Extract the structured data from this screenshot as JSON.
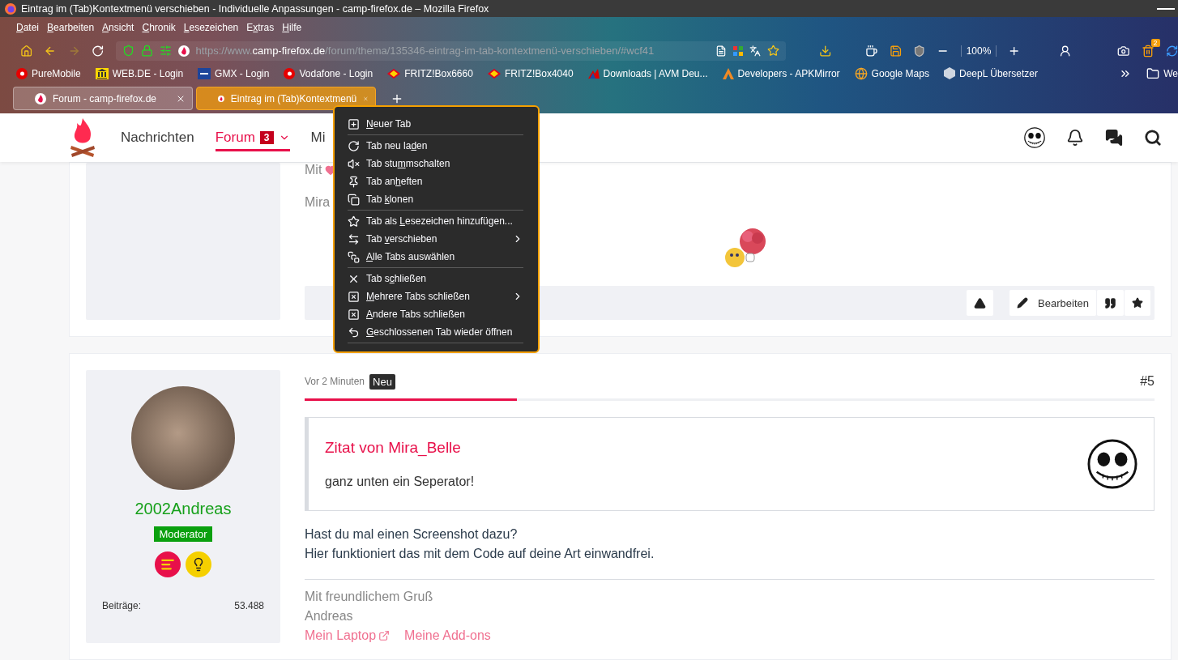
{
  "window": {
    "title": "Eintrag im (Tab)Kontextmenü verschieben - Individuelle Anpassungen - camp-firefox.de – Mozilla Firefox"
  },
  "menubar": [
    {
      "key": "D",
      "post": "atei"
    },
    {
      "key": "B",
      "post": "earbeiten"
    },
    {
      "key": "A",
      "post": "nsicht"
    },
    {
      "key": "C",
      "post": "hronik"
    },
    {
      "key": "L",
      "post": "esezeichen"
    },
    {
      "pre": "E",
      "key": "x",
      "post": "tras"
    },
    {
      "key": "H",
      "post": "ilfe"
    }
  ],
  "navbar": {
    "forward": {
      "disabled": true
    },
    "url": {
      "prefix": "https://www.",
      "host": "camp-firefox.de",
      "path": "/forum/thema/135346-eintrag-im-tab-kontextmenü-verschieben/#wcf41"
    },
    "zoom": "100%",
    "extension_badge": "2"
  },
  "bookmarks": [
    {
      "kind": "vodafone",
      "label": "PureMobile"
    },
    {
      "kind": "webde",
      "label": "WEB.DE - Login"
    },
    {
      "kind": "gmx",
      "label": "GMX - Login"
    },
    {
      "kind": "vodafone",
      "label": "Vodafone - Login"
    },
    {
      "kind": "fritz",
      "label": "FRITZ!Box6660"
    },
    {
      "kind": "fritz",
      "label": "FRITZ!Box4040"
    },
    {
      "kind": "avm",
      "label": "Downloads | AVM Deu..."
    },
    {
      "kind": "apk",
      "label": "Developers - APKMirror"
    },
    {
      "kind": "globe",
      "label": "Google Maps"
    },
    {
      "kind": "deepl",
      "label": "DeepL Übersetzer"
    },
    {
      "kind": "folder",
      "label": "We"
    }
  ],
  "tabs": [
    {
      "label": "Forum - camp-firefox.de",
      "selected": false
    },
    {
      "label": "Eintrag im (Tab)Kontextmenü",
      "selected": true
    }
  ],
  "site_nav": [
    {
      "label": "Nachrichten",
      "selected": false
    },
    {
      "label": "Forum",
      "selected": true,
      "badge": "3"
    },
    {
      "label": "Mi",
      "selected": false
    }
  ],
  "context_menu": {
    "sections": [
      [
        {
          "kind": "newtab",
          "key": "N",
          "post": "euer Tab",
          "submenu": false
        }
      ],
      [
        {
          "kind": "reload",
          "pre": "Tab neu la",
          "key": "d",
          "post": "en",
          "submenu": false
        },
        {
          "kind": "mute",
          "pre": "Tab stu",
          "key": "m",
          "post": "mschalten",
          "submenu": false
        },
        {
          "kind": "pin",
          "pre": "Tab an",
          "key": "h",
          "post": "eften",
          "submenu": false
        },
        {
          "kind": "clone",
          "pre": "Tab ",
          "key": "k",
          "post": "lonen",
          "submenu": false
        }
      ],
      [
        {
          "kind": "bookmark",
          "pre": "Tab als ",
          "key": "L",
          "post": "esezeichen hinzufügen...",
          "submenu": false
        },
        {
          "kind": "move",
          "pre": "Tab ",
          "key": "v",
          "post": "erschieben",
          "submenu": true
        },
        {
          "kind": "selectall",
          "key": "A",
          "post": "lle Tabs auswählen",
          "submenu": false
        }
      ],
      [
        {
          "kind": "close",
          "pre": "Tab s",
          "key": "c",
          "post": "hließen",
          "submenu": false
        },
        {
          "kind": "closemulti",
          "key": "M",
          "post": "ehrere Tabs schließen",
          "submenu": true
        },
        {
          "kind": "closeothers",
          "key": "A",
          "post": "ndere Tabs schließen",
          "submenu": false
        },
        {
          "kind": "undo",
          "key": "G",
          "post": "eschlossenen Tab wieder öffnen",
          "submenu": false
        }
      ]
    ]
  },
  "posts": [
    {
      "lines": [
        "Mit",
        "Mira"
      ],
      "actions": [
        {
          "kind": "report"
        },
        {
          "kind": "edit",
          "label": "Bearbeiten"
        },
        {
          "kind": "quote"
        },
        {
          "kind": "star"
        }
      ]
    },
    {
      "author": "2002Andreas",
      "rank": "Moderator",
      "stats": [
        {
          "label": "Beiträge:",
          "value": "53.488"
        }
      ],
      "time": "Vor 2 Minuten",
      "new_badge": "Neu",
      "number": "#5",
      "read_progress": {
        "level": 0.25
      },
      "quote": {
        "title": "Zitat von Mira_Belle",
        "text": "ganz unten ein Seperator!"
      },
      "body": [
        "Hast du mal einen Screenshot dazu?",
        "Hier funktioniert das mit dem Code auf deine Art einwandfrei."
      ],
      "signature": [
        "Mit freundlichem Gruß",
        "Andreas"
      ],
      "links": [
        {
          "label": "Mein Laptop",
          "external": true
        },
        {
          "label": "Meine Add-ons",
          "external": false
        }
      ]
    }
  ]
}
